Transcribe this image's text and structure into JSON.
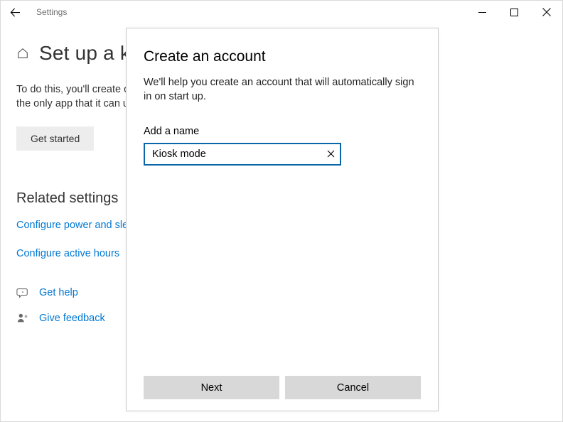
{
  "window": {
    "title": "Settings"
  },
  "page": {
    "heading": "Set up a k",
    "description": "To do this, you'll create or choose an account to sign in automatically, then choose the only app that it can use (such as your company's app for customers or guests).",
    "getStarted": "Get started",
    "relatedHeading": "Related settings",
    "linkPower": "Configure power and sle",
    "linkHours": "Configure active hours",
    "help": "Get help",
    "feedback": "Give feedback"
  },
  "dialog": {
    "title": "Create an account",
    "description": "We'll help you create an account that will automatically sign in on start up.",
    "fieldLabel": "Add a name",
    "inputValue": "Kiosk mode",
    "next": "Next",
    "cancel": "Cancel"
  }
}
